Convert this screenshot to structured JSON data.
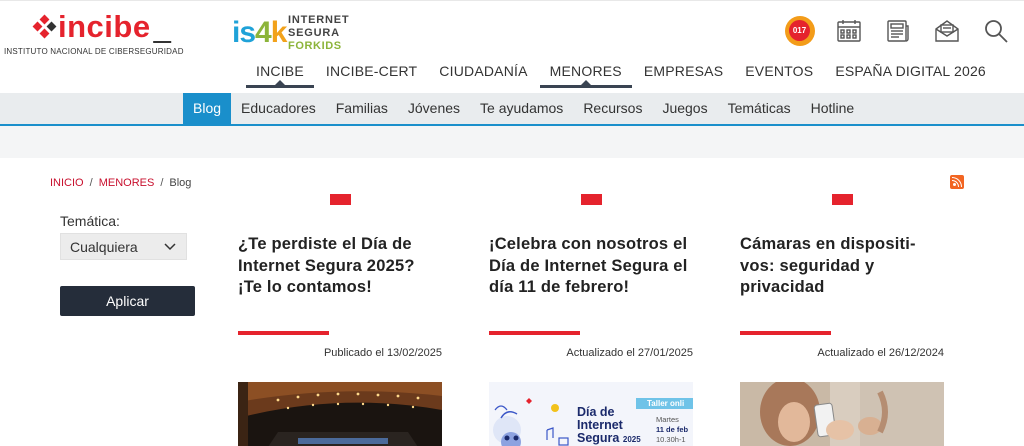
{
  "header": {
    "logo_incibe": {
      "prefix": "i",
      "word": "ncibe",
      "cursor": "_",
      "subtitle": "INSTITUTO NACIONAL DE CIBERSEGURIDAD"
    },
    "logo_is4k": {
      "is": "is",
      "four": "4",
      "k": "k",
      "line1": "INTERNET",
      "line2": "SEGURA",
      "line3": "FORKIDS"
    },
    "helpline_badge": "017",
    "main_nav": [
      {
        "label": "INCIBE"
      },
      {
        "label": "INCIBE-CERT"
      },
      {
        "label": "CIUDADANÍA"
      },
      {
        "label": "MENORES"
      },
      {
        "label": "EMPRESAS"
      },
      {
        "label": "EVENTOS"
      },
      {
        "label": "ESPAÑA DIGITAL 2026"
      }
    ]
  },
  "subnav": [
    {
      "label": "Blog"
    },
    {
      "label": "Educadores"
    },
    {
      "label": "Familias"
    },
    {
      "label": "Jóvenes"
    },
    {
      "label": "Te ayudamos"
    },
    {
      "label": "Recursos"
    },
    {
      "label": "Juegos"
    },
    {
      "label": "Temáticas"
    },
    {
      "label": "Hotline"
    }
  ],
  "breadcrumb": {
    "home": "Inicio",
    "section": "Menores",
    "separator": "/",
    "current": "Blog"
  },
  "filter": {
    "label": "Temática:",
    "selected": "Cualquiera",
    "apply_label": "Aplicar"
  },
  "posts": [
    {
      "title": "¿Te perdiste el Día de Internet Segura 2025? ¡Te lo contamos!",
      "date": "Publicado el 13/02/2025"
    },
    {
      "title": "¡Celebra con nosotros el Día de Internet Segura el día 11 de febrero!",
      "date": "Actualizado el 27/01/2025",
      "thumb_text": {
        "tag": "Taller onli",
        "headline1": "Día de",
        "headline2": "Internet",
        "headline3": "Segura",
        "year": "2025",
        "day": "Martes",
        "date": "11 de feb",
        "time": "10.30h-1"
      }
    },
    {
      "title": "Cámaras en dispositi-vos: seguridad y privacidad",
      "date": "Actualizado el 26/12/2024"
    }
  ],
  "colors": {
    "brand_red": "#e5232d",
    "accent_blue": "#1a8fcb",
    "dark_button": "#252d3a"
  }
}
